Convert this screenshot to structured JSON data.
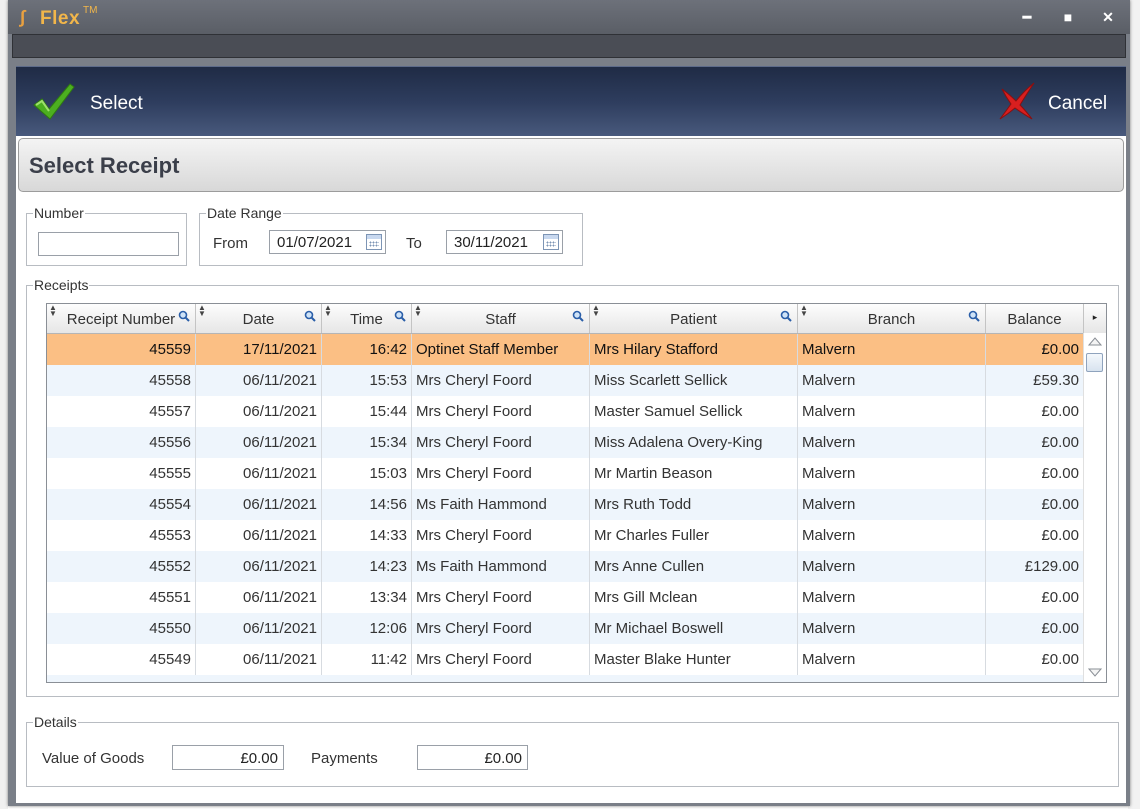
{
  "app": {
    "name": "Flex",
    "trademark": "TM"
  },
  "window_controls": {
    "minimize": "━",
    "maximize": "■",
    "close": "✕"
  },
  "actions": {
    "select_label": "Select",
    "cancel_label": "Cancel"
  },
  "page_title": "Select Receipt",
  "filters": {
    "number_legend": "Number",
    "number_value": "",
    "date_range_legend": "Date Range",
    "from_label": "From",
    "from_value": "01/07/2021",
    "to_label": "To",
    "to_value": "30/11/2021"
  },
  "receipts": {
    "legend": "Receipts",
    "columns": [
      "Receipt Number",
      "Date",
      "Time",
      "Staff",
      "Patient",
      "Branch",
      "Balance"
    ],
    "rows": [
      {
        "number": "45559",
        "date": "17/11/2021",
        "time": "16:42",
        "staff": "Optinet Staff Member",
        "patient": "Mrs Hilary Stafford",
        "branch": "Malvern",
        "balance": "£0.00",
        "selected": true
      },
      {
        "number": "45558",
        "date": "06/11/2021",
        "time": "15:53",
        "staff": "Mrs Cheryl Foord",
        "patient": "Miss Scarlett Sellick",
        "branch": "Malvern",
        "balance": "£59.30"
      },
      {
        "number": "45557",
        "date": "06/11/2021",
        "time": "15:44",
        "staff": "Mrs Cheryl Foord",
        "patient": "Master Samuel Sellick",
        "branch": "Malvern",
        "balance": "£0.00"
      },
      {
        "number": "45556",
        "date": "06/11/2021",
        "time": "15:34",
        "staff": "Mrs Cheryl Foord",
        "patient": "Miss Adalena Overy-King",
        "branch": "Malvern",
        "balance": "£0.00"
      },
      {
        "number": "45555",
        "date": "06/11/2021",
        "time": "15:03",
        "staff": "Mrs Cheryl Foord",
        "patient": "Mr Martin Beason",
        "branch": "Malvern",
        "balance": "£0.00"
      },
      {
        "number": "45554",
        "date": "06/11/2021",
        "time": "14:56",
        "staff": "Ms Faith Hammond",
        "patient": "Mrs Ruth Todd",
        "branch": "Malvern",
        "balance": "£0.00"
      },
      {
        "number": "45553",
        "date": "06/11/2021",
        "time": "14:33",
        "staff": "Mrs Cheryl Foord",
        "patient": "Mr Charles Fuller",
        "branch": "Malvern",
        "balance": "£0.00"
      },
      {
        "number": "45552",
        "date": "06/11/2021",
        "time": "14:23",
        "staff": "Ms Faith Hammond",
        "patient": "Mrs Anne Cullen",
        "branch": "Malvern",
        "balance": "£129.00"
      },
      {
        "number": "45551",
        "date": "06/11/2021",
        "time": "13:34",
        "staff": "Mrs Cheryl Foord",
        "patient": "Mrs Gill Mclean",
        "branch": "Malvern",
        "balance": "£0.00"
      },
      {
        "number": "45550",
        "date": "06/11/2021",
        "time": "12:06",
        "staff": "Mrs Cheryl Foord",
        "patient": "Mr Michael Boswell",
        "branch": "Malvern",
        "balance": "£0.00"
      },
      {
        "number": "45549",
        "date": "06/11/2021",
        "time": "11:42",
        "staff": "Mrs Cheryl Foord",
        "patient": "Master Blake Hunter",
        "branch": "Malvern",
        "balance": "£0.00"
      }
    ]
  },
  "details": {
    "legend": "Details",
    "value_of_goods_label": "Value of Goods",
    "value_of_goods": "£0.00",
    "payments_label": "Payments",
    "payments": "£0.00"
  },
  "colors": {
    "selected_row": "#fbbf84",
    "alt_row": "#eef5fc",
    "accent_title": "#f2b64a",
    "check_green": "#4caf20",
    "cancel_red": "#d81f1f"
  },
  "icons": [
    "flex-logo-icon",
    "check-icon",
    "cancel-x-icon",
    "calendar-icon",
    "magnifier-icon",
    "sort-icon",
    "scroll-up-icon",
    "scroll-down-icon"
  ]
}
